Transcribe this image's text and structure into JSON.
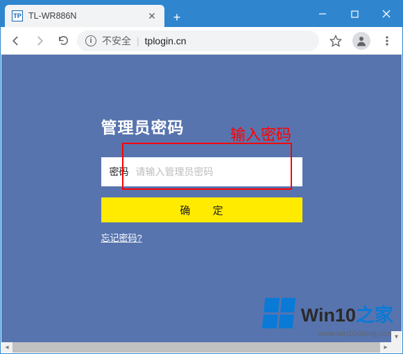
{
  "browser": {
    "tab": {
      "favicon_text": "TP",
      "title": "TL-WR886N"
    },
    "address": {
      "security_text": "不安全",
      "url": "tplogin.cn"
    }
  },
  "page": {
    "title": "管理员密码",
    "password_label": "密码",
    "password_placeholder": "请输入管理员密码",
    "confirm_label": "确 定",
    "forgot_label": "忘记密码?"
  },
  "annotation": {
    "hint_text": "输入密码"
  },
  "watermark": {
    "brand_a": "Win10",
    "brand_b": "之家",
    "url": "www.win10xitong.com"
  }
}
